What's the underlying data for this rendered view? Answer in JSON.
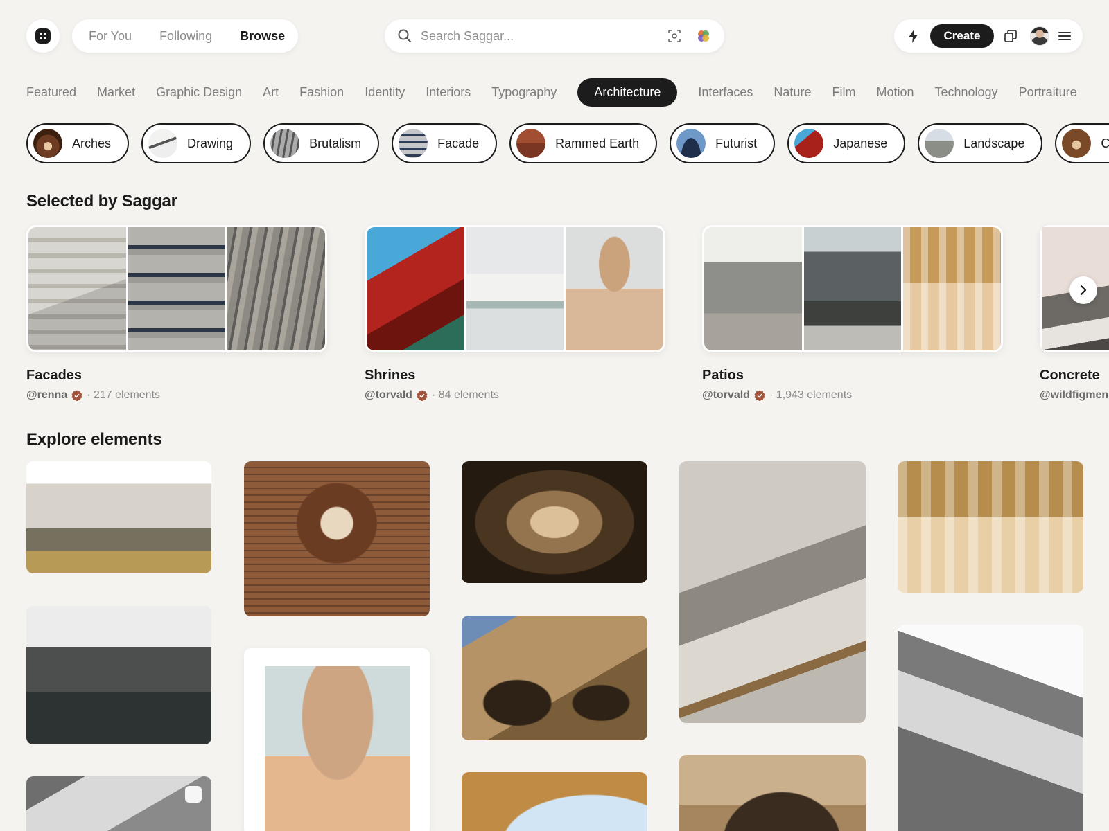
{
  "nav": {
    "tabs": [
      {
        "label": "For You"
      },
      {
        "label": "Following"
      },
      {
        "label": "Browse"
      }
    ]
  },
  "search": {
    "placeholder": "Search Saggar..."
  },
  "actions": {
    "create_label": "Create"
  },
  "categories": [
    "Featured",
    "Market",
    "Graphic Design",
    "Art",
    "Fashion",
    "Identity",
    "Interiors",
    "Typography",
    "Architecture",
    "Interfaces",
    "Nature",
    "Film",
    "Motion",
    "Technology",
    "Portraiture"
  ],
  "active_category": "Architecture",
  "chips": [
    {
      "label": "Arches"
    },
    {
      "label": "Drawing"
    },
    {
      "label": "Brutalism"
    },
    {
      "label": "Facade"
    },
    {
      "label": "Rammed Earth"
    },
    {
      "label": "Futurist"
    },
    {
      "label": "Japanese"
    },
    {
      "label": "Landscape"
    },
    {
      "label": "Co"
    }
  ],
  "selected": {
    "heading": "Selected by Saggar",
    "collections": [
      {
        "title": "Facades",
        "user": "@renna",
        "count": "· 217 elements"
      },
      {
        "title": "Shrines",
        "user": "@torvald",
        "count": "· 84 elements"
      },
      {
        "title": "Patios",
        "user": "@torvald",
        "count": "· 1,943 elements"
      },
      {
        "title": "Concrete",
        "user": "@wildfigmen",
        "count": ""
      }
    ]
  },
  "explore": {
    "heading": "Explore elements"
  },
  "colors": {
    "background": "#f5f3ef",
    "accent_dark": "#1c1c1c",
    "verified_badge": "#a0523a",
    "muted_text": "#8a8a8a"
  },
  "icons": [
    "logo-icon",
    "search-icon",
    "visual-search-icon",
    "color-search-icon",
    "bolt-icon",
    "copy-icon",
    "menu-icon",
    "verified-icon",
    "chevron-right-icon"
  ]
}
